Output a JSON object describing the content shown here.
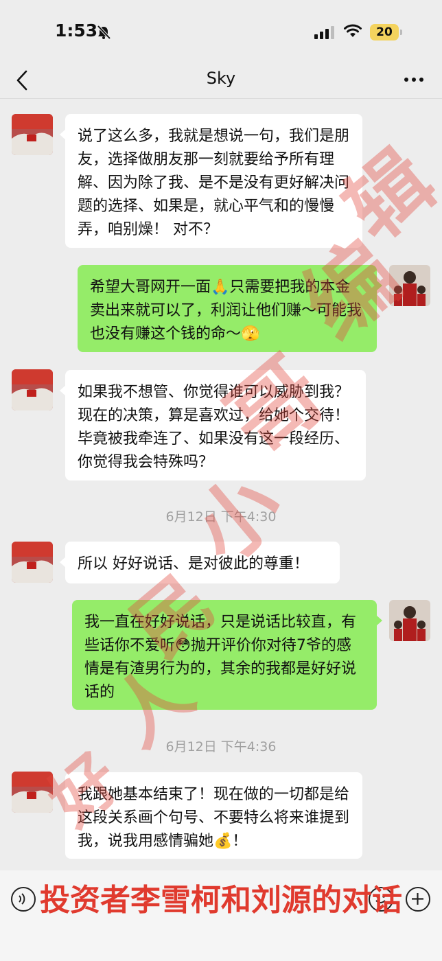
{
  "status_bar": {
    "time": "1:53",
    "battery": "20"
  },
  "header": {
    "title": "Sky"
  },
  "messages": [
    {
      "text": "说了这么多，我就是想说一句，我们是朋友，选择做朋友那一刻就要给予所有理解、因为除了我、是不是没有更好解决问题的选择、如果是，就心平气和的慢慢弄，咱别燥！ 对不？"
    },
    {
      "text": "希望大哥网开一面🙏只需要把我的本金卖出来就可以了，利润让他们赚～可能我也没有赚这个钱的命～🫣"
    },
    {
      "text": "如果我不想管、你觉得谁可以威胁到我？ 现在的决策，算是喜欢过，给她个交待！毕竟被我牵连了、如果没有这一段经历、你觉得我会特殊吗？"
    },
    {
      "text": "所以 好好说话、是对彼此的尊重！"
    },
    {
      "text": "我一直在好好说话，只是说话比较直，有些话你不爱听😳抛开评价你对待7爷的感情是有渣男行为的，其余的我都是好好说话的"
    },
    {
      "text": "我跟她基本结束了！现在做的一切都是给这段关系画个句号、不要特么将来谁提到我，说我用感情骗她💰！"
    }
  ],
  "timestamps": [
    "6月12日 下午4:30",
    "6月12日 下午4:36"
  ],
  "watermark": [
    "好",
    "人",
    "民",
    "小",
    "哥",
    "编",
    "辑"
  ],
  "caption": "投资者李雪柯和刘源的对话",
  "colors": {
    "outgoing_bubble": "#95ec69",
    "incoming_bubble": "#ffffff",
    "background": "#ededed",
    "watermark": "#e2463c"
  }
}
